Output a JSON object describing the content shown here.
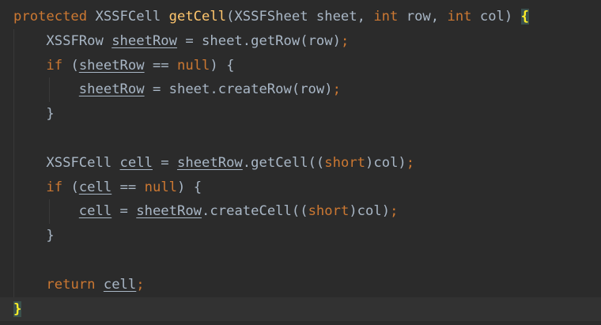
{
  "colors": {
    "background": "#2b2b2b",
    "keyword": "#cc7832",
    "function": "#ffc66d",
    "text": "#a9b7c6",
    "brace_match": "#ffef28",
    "brace_match_bg": "#3b514d",
    "current_line": "#323232"
  },
  "code": {
    "l1": {
      "t1": "protected",
      "t2": " XSSFCell ",
      "t3": "getCell",
      "t4": "(XSSFSheet sheet, ",
      "t5": "int",
      "t6": " row, ",
      "t7": "int",
      "t8": " col) ",
      "t9": "{"
    },
    "l2": {
      "t1": "XSSFRow ",
      "t2": "sheetRow",
      "t3": " = sheet.getRow(row)",
      "t4": ";"
    },
    "l3": {
      "t1": "if",
      "t2": " (",
      "t3": "sheetRow",
      "t4": " == ",
      "t5": "null",
      "t6": ") {"
    },
    "l4": {
      "t1": "sheetRow",
      "t2": " = sheet.createRow(row)",
      "t3": ";"
    },
    "l5": {
      "t1": "}"
    },
    "l7": {
      "t1": "XSSFCell ",
      "t2": "cell",
      "t3": " = ",
      "t4": "sheetRow",
      "t5": ".getCell((",
      "t6": "short",
      "t7": ")col)",
      "t8": ";"
    },
    "l8": {
      "t1": "if",
      "t2": " (",
      "t3": "cell",
      "t4": " == ",
      "t5": "null",
      "t6": ") {"
    },
    "l9": {
      "t1": "cell",
      "t2": " = ",
      "t3": "sheetRow",
      "t4": ".createCell((",
      "t5": "short",
      "t6": ")col)",
      "t7": ";"
    },
    "l10": {
      "t1": "}"
    },
    "l12": {
      "t1": "return",
      "t2": " ",
      "t3": "cell",
      "t4": ";"
    },
    "l13": {
      "t1": "}"
    }
  }
}
